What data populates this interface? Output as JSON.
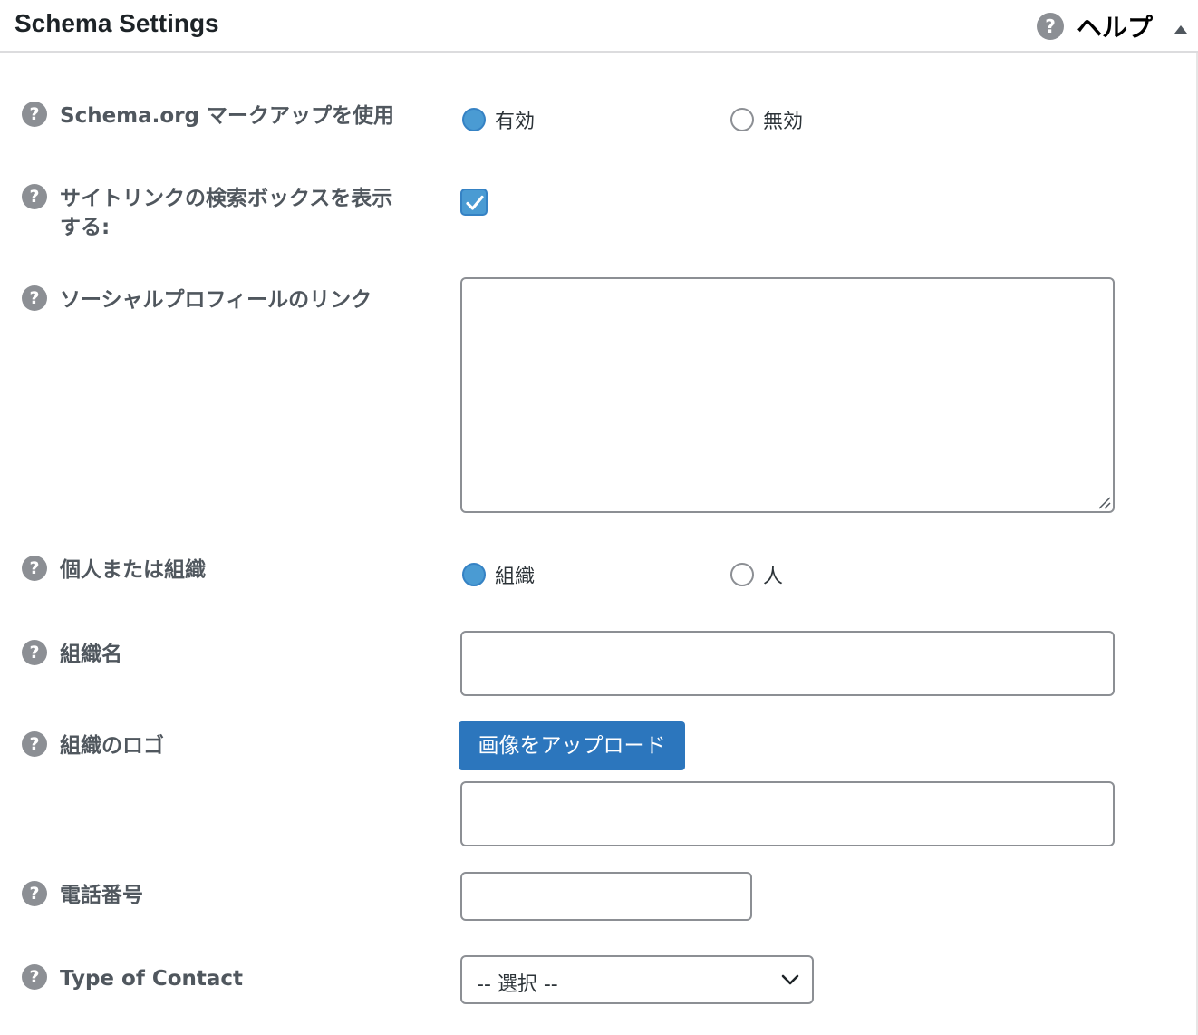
{
  "header": {
    "title": "Schema Settings",
    "help_label": "ヘルプ",
    "help_icon": "question-circle-icon",
    "collapse_icon": "triangle-up-icon"
  },
  "rows": {
    "schema_markup": {
      "label": "Schema.org マークアップを使用",
      "options": [
        {
          "label": "有効",
          "checked": true
        },
        {
          "label": "無効",
          "checked": false
        }
      ]
    },
    "sitelinks_search": {
      "label_line1": "サイトリンクの検索ボックスを表示",
      "label_line2": "する:",
      "checked": true
    },
    "social_profiles": {
      "label": "ソーシャルプロフィールのリンク",
      "value": ""
    },
    "person_or_org": {
      "label": "個人または組織",
      "options": [
        {
          "label": "組織",
          "checked": true
        },
        {
          "label": "人",
          "checked": false
        }
      ]
    },
    "org_name": {
      "label": "組織名",
      "value": ""
    },
    "org_logo": {
      "label": "組織のロゴ",
      "button_label": "画像をアップロード",
      "value": ""
    },
    "phone": {
      "label": "電話番号",
      "value": ""
    },
    "contact_type": {
      "label": "Type of Contact",
      "selected": "-- 選択 --"
    }
  },
  "colors": {
    "accent": "#2c76bd",
    "radio_checked": "#4a9bd3",
    "label_text": "#50575e",
    "help_icon_bg": "#8c8f94",
    "border": "#8c8f94"
  }
}
